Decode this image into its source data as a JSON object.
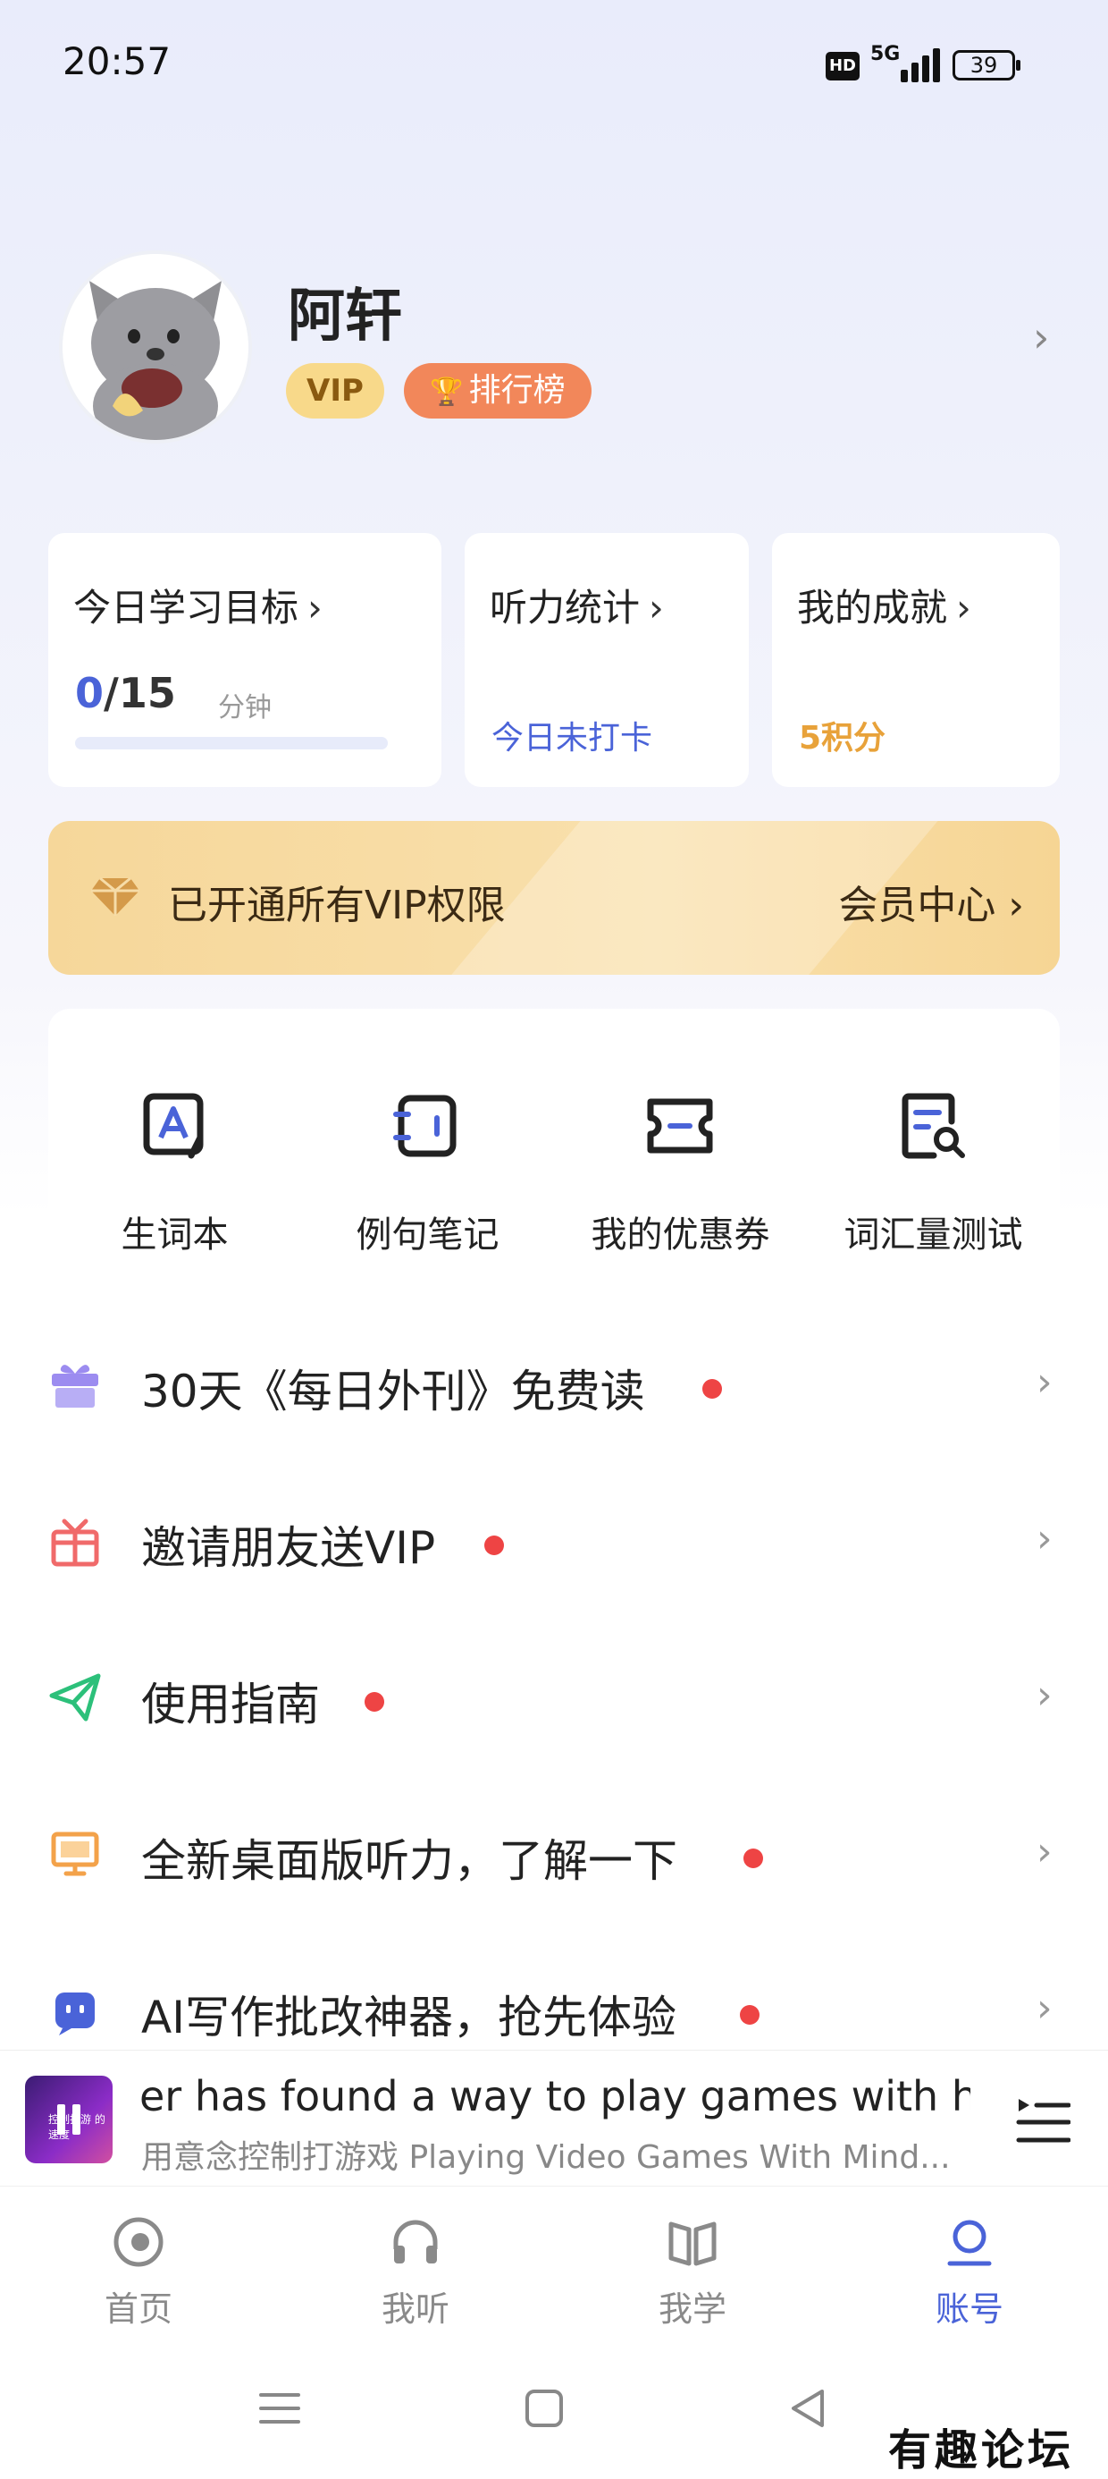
{
  "status_bar": {
    "time": "20:57",
    "hd": "HD",
    "network": "5G",
    "battery": "39"
  },
  "profile": {
    "name": "阿轩",
    "vip_badge": "VIP",
    "rank_badge": "排行榜"
  },
  "stats": {
    "goal": {
      "title": "今日学习目标",
      "current": "0",
      "target": "/15",
      "unit": "分钟",
      "progress": 0
    },
    "listening": {
      "title": "听力统计",
      "status": "今日未打卡"
    },
    "achievement": {
      "title": "我的成就",
      "points": "5积分"
    }
  },
  "vip_banner": {
    "text": "已开通所有VIP权限",
    "link": "会员中心"
  },
  "tools": [
    {
      "label": "生词本",
      "icon": "vocabulary-book-icon"
    },
    {
      "label": "例句笔记",
      "icon": "sentence-notes-icon"
    },
    {
      "label": "我的优惠券",
      "icon": "coupon-icon"
    },
    {
      "label": "词汇量测试",
      "icon": "vocab-test-icon"
    }
  ],
  "menu": [
    {
      "label": "30天《每日外刊》免费读",
      "icon": "gift-box-icon",
      "icon_color": "#9c8cf0"
    },
    {
      "label": "邀请朋友送VIP",
      "icon": "gift-icon",
      "icon_color": "#f06a6a"
    },
    {
      "label": "使用指南",
      "icon": "paper-plane-icon",
      "icon_color": "#2cc07a"
    },
    {
      "label": "全新桌面版听力，了解一下",
      "icon": "monitor-icon",
      "icon_color": "#f3a24a"
    },
    {
      "label": "AI写作批改神器，抢先体验",
      "icon": "ai-robot-icon",
      "icon_color": "#4a63d8"
    }
  ],
  "player": {
    "title": "er has found a way to play games with her r",
    "subtitle": "用意念控制打游戏 Playing Video Games With Mind...",
    "cover_caption": "控制打游 的速度"
  },
  "tabs": [
    {
      "label": "首页",
      "icon": "home-icon"
    },
    {
      "label": "我听",
      "icon": "headphones-icon"
    },
    {
      "label": "我学",
      "icon": "book-icon"
    },
    {
      "label": "账号",
      "icon": "account-icon",
      "active": true
    }
  ],
  "watermark": "有趣论坛",
  "colors": {
    "accent": "#4a63d8",
    "vip_gold": "#f8d98a",
    "rank_orange": "#f2875a",
    "points_orange": "#e8a23a",
    "red_dot": "#ee4444"
  }
}
